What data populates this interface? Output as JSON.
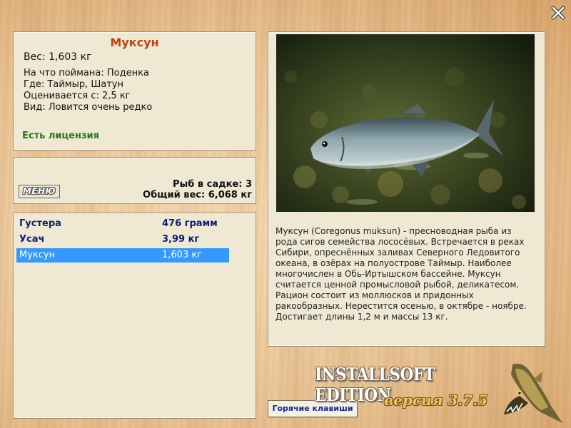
{
  "fish": {
    "name": "Муксун",
    "weight": "Вес: 1,603 кг",
    "caught_on": "На что поймана: Поденка",
    "where": "Где: Таймыр, Шатун",
    "estimated": "Оценивается с: 2,5 кг",
    "kind": "Вид: Ловится очень редко",
    "license": "Есть лицензия"
  },
  "status": {
    "menu_label": "МЕНЮ",
    "cage_count": "Рыб в садке: 3",
    "total_weight": "Общий вес: 6,068 кг"
  },
  "catch_list": [
    {
      "name": "Густера",
      "weight": "476 грамм",
      "selected": false
    },
    {
      "name": "Усач",
      "weight": "3,99 кг",
      "selected": false
    },
    {
      "name": "Муксун",
      "weight": "1,603 кг",
      "selected": true
    }
  ],
  "description": "Муксун (Coregonus muksun) - пресноводная рыба из рода сигов семейства лососёвых. Встречается в реках Сибири, опреснённых заливах Северного Ледовитого океана, в озёрах на полуострове Таймыр. Наиболее многочислен в Обь-Иртышском бассейне. Муксун считается ценной промысловой рыбой, деликатесом. Рацион состоит из моллюсков и придонных ракообразных. Нерестится осенью, в октябре - ноябре. Достигает длины 1,2 м и массы 13 кг.",
  "hotkeys_label": "Горячие клавиши",
  "brand": "INSTALLSOFT EDITION",
  "version": "версия 3.7.5",
  "icons": {
    "close": "close-icon",
    "photo": "fish-photo",
    "logo": "pike-icon"
  },
  "colors": {
    "fish_name": "#c0430f",
    "license": "#217a17",
    "list_text": "#0c1e7a",
    "selected_row": "#3399ff",
    "hotkeys_text": "#0f2c9a"
  }
}
